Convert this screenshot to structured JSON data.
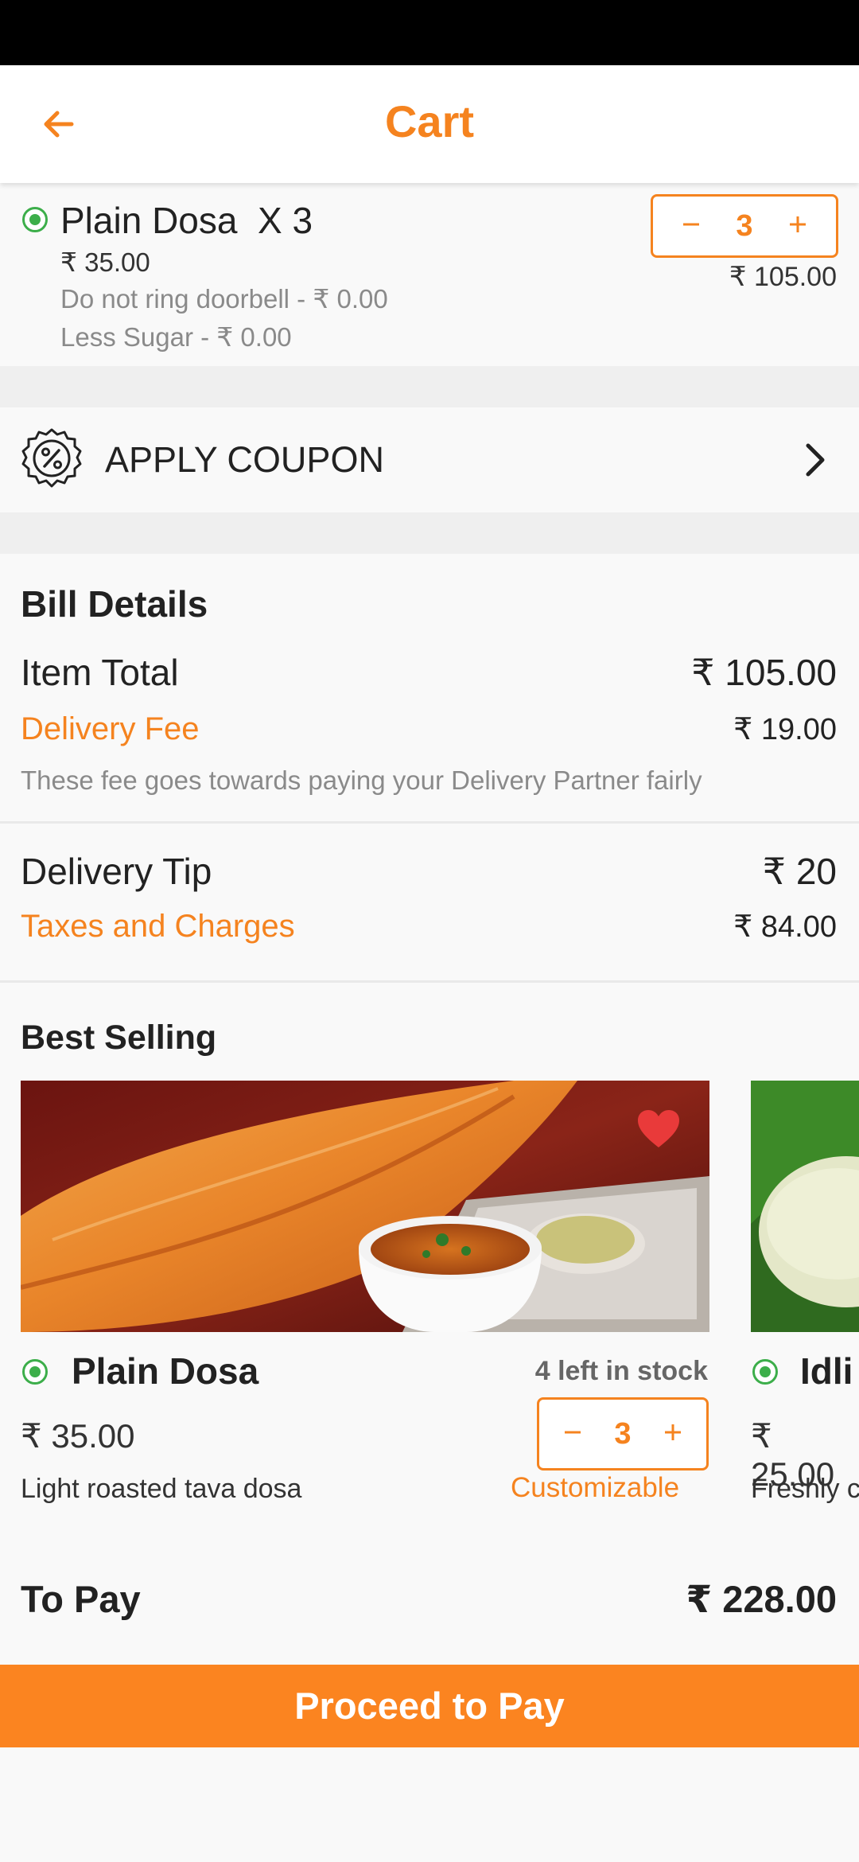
{
  "header": {
    "title": "Cart"
  },
  "cart_item": {
    "name": "Plain Dosa",
    "qty_label": "X 3",
    "unit_price": "₹ 35.00",
    "addons": [
      "Do not ring doorbell - ₹ 0.00",
      "Less Sugar - ₹ 0.00"
    ],
    "quantity": "3",
    "total": "₹ 105.00"
  },
  "coupon": {
    "label": "APPLY COUPON"
  },
  "bill": {
    "title": "Bill Details",
    "item_total_label": "Item Total",
    "item_total_value": "₹ 105.00",
    "delivery_fee_label": "Delivery Fee",
    "delivery_fee_value": "₹ 19.00",
    "delivery_note": "These fee goes towards paying your Delivery Partner fairly",
    "tip_label": "Delivery Tip",
    "tip_value": "₹ 20",
    "taxes_label": "Taxes and Charges",
    "taxes_value": "₹ 84.00"
  },
  "best_selling": {
    "title": "Best Selling",
    "items": [
      {
        "name": "Plain Dosa",
        "price": "₹ 35.00",
        "description": "Light roasted tava dosa",
        "stock": "4 left in stock",
        "quantity": "3",
        "customizable": "Customizable"
      },
      {
        "name": "Idli",
        "price": "₹ 25.00",
        "description": "Freshly c"
      }
    ]
  },
  "to_pay": {
    "label": "To Pay",
    "value": "₹ 228.00"
  },
  "proceed_button": {
    "label": "Proceed to Pay"
  },
  "icons": {
    "back": "arrow-left-icon",
    "minus": "minus-icon",
    "plus": "plus-icon",
    "coupon": "coupon-badge-icon",
    "chevron": "chevron-right-icon",
    "heart": "heart-icon",
    "veg": "veg-indicator-icon"
  },
  "colors": {
    "accent": "#f5831f",
    "button": "#fb8420",
    "veg": "#3cae4a",
    "heart": "#e93a3a"
  }
}
